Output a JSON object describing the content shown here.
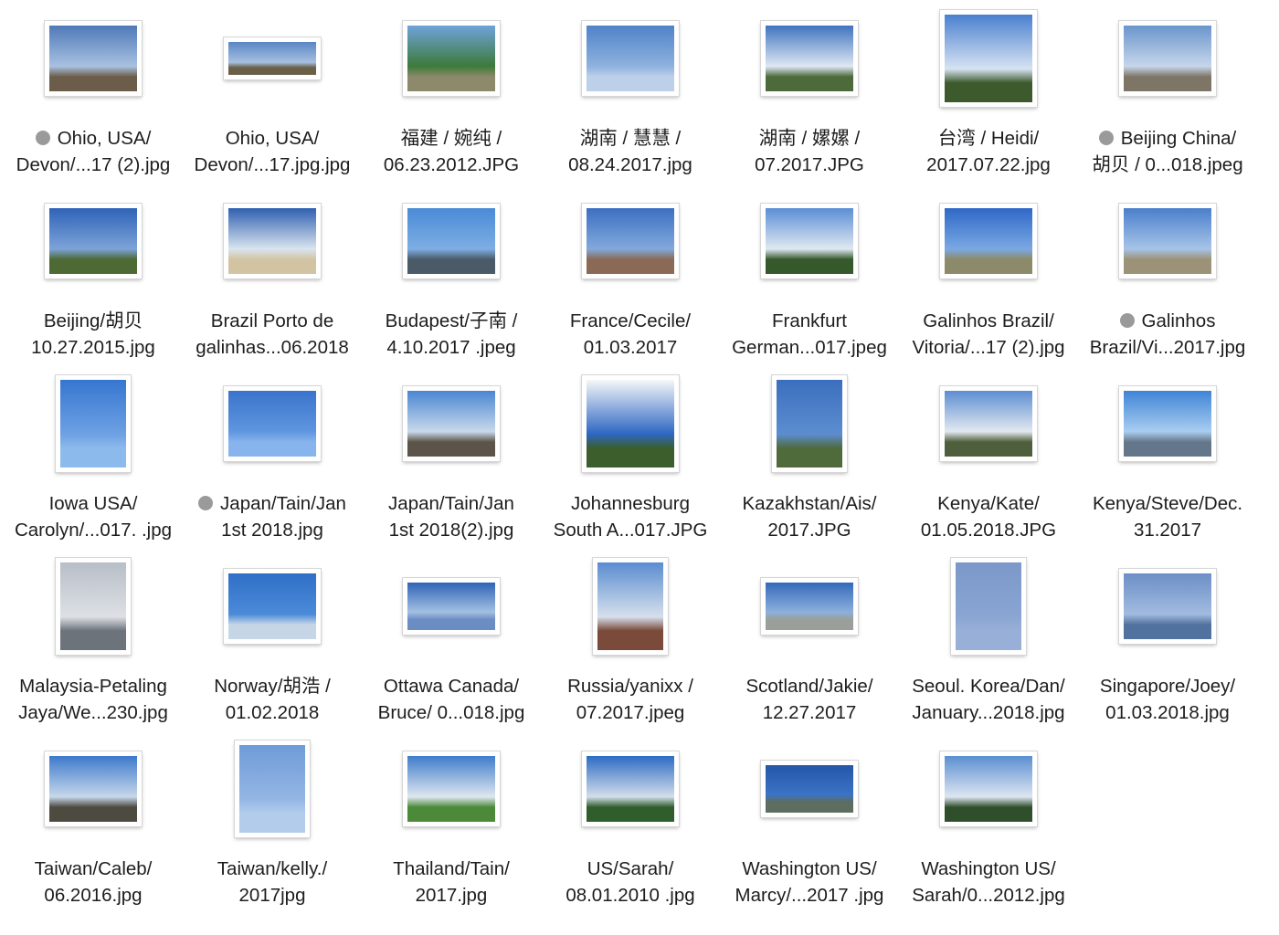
{
  "files": [
    {
      "name": "Ohio, USA/ Devon/...17 (2).jpg",
      "line1": "Ohio, USA/",
      "line2": "Devon/...17 (2).jpg",
      "tagged": true,
      "shape": "landscape",
      "colors": [
        "#4f79b8",
        "#a9c1e0",
        "#6b5d4a"
      ]
    },
    {
      "name": "Ohio, USA/ Devon/...17.jpg.jpg",
      "line1": "Ohio, USA/",
      "line2": "Devon/...17.jpg.jpg",
      "tagged": false,
      "shape": "wide",
      "colors": [
        "#5a86c4",
        "#a6c0e0",
        "#6a6048"
      ]
    },
    {
      "name": "福建 / 婉纯 / 06.23.2012.JPG",
      "line1": "福建 / 婉纯 /",
      "line2": "06.23.2012.JPG",
      "tagged": false,
      "shape": "landscape",
      "colors": [
        "#6fa3da",
        "#3d7a3a",
        "#8c8a6a"
      ]
    },
    {
      "name": "湖南 / 慧慧 / 08.24.2017.jpg",
      "line1": "湖南 / 慧慧 /",
      "line2": "08.24.2017.jpg",
      "tagged": false,
      "shape": "landscape",
      "colors": [
        "#4f82c8",
        "#8fb2de",
        "#bcd0ea"
      ]
    },
    {
      "name": "湖南 / 嫘嫘 / 07.2017.JPG",
      "line1": "湖南 / 嫘嫘 /",
      "line2": "07.2017.JPG",
      "tagged": false,
      "shape": "landscape",
      "colors": [
        "#3f74bf",
        "#dfe8f3",
        "#4c6a3a"
      ]
    },
    {
      "name": "台湾 / Heidi/ 2017.07.22.jpg",
      "line1": "台湾 / Heidi/",
      "line2": "2017.07.22.jpg",
      "tagged": false,
      "shape": "square",
      "colors": [
        "#4a80cf",
        "#d7e3f2",
        "#3d5a2c"
      ]
    },
    {
      "name": "Beijing China/ 胡贝 / 0...018.jpeg",
      "line1": "Beijing China/",
      "line2": "胡贝 / 0...018.jpeg",
      "tagged": true,
      "shape": "landscape",
      "colors": [
        "#6a95cc",
        "#c7d6ea",
        "#7d7565"
      ]
    },
    {
      "name": "Beijing/胡贝 10.27.2015.jpg",
      "line1": "Beijing/胡贝",
      "line2": "10.27.2015.jpg",
      "tagged": false,
      "shape": "landscape",
      "colors": [
        "#2f63b8",
        "#7da3d8",
        "#4d6a35"
      ]
    },
    {
      "name": "Brazil Porto de galinhas...06.2018",
      "line1": "Brazil Porto de",
      "line2": "galinhas...06.2018",
      "tagged": false,
      "shape": "landscape",
      "colors": [
        "#2f60b0",
        "#d9e4ef",
        "#d2c4a2"
      ]
    },
    {
      "name": "Budapest/子南 / 4.10.2017 .jpeg",
      "line1": "Budapest/子南 /",
      "line2": "4.10.2017 .jpeg",
      "tagged": false,
      "shape": "landscape",
      "colors": [
        "#4a8ad6",
        "#7eaee4",
        "#4a5a66"
      ]
    },
    {
      "name": "France/Cecile/ 01.03.2017",
      "line1": "France/Cecile/",
      "line2": "01.03.2017",
      "tagged": false,
      "shape": "landscape",
      "colors": [
        "#3c6fc2",
        "#82a9dc",
        "#8a6a55"
      ]
    },
    {
      "name": "Frankfurt German...017.jpeg",
      "line1": "Frankfurt",
      "line2": "German...017.jpeg",
      "tagged": false,
      "shape": "landscape",
      "colors": [
        "#5a8ed4",
        "#e0e8f2",
        "#35592b"
      ]
    },
    {
      "name": "Galinhos Brazil/ Vitoria/...17 (2).jpg",
      "line1": "Galinhos Brazil/",
      "line2": "Vitoria/...17 (2).jpg",
      "tagged": false,
      "shape": "landscape",
      "colors": [
        "#2f68c6",
        "#7aa8e3",
        "#8d8a6a"
      ]
    },
    {
      "name": "Galinhos Brazil/Vi...2017.jpg",
      "line1": "Galinhos",
      "line2": "Brazil/Vi...2017.jpg",
      "tagged": true,
      "shape": "landscape",
      "colors": [
        "#4a7fcc",
        "#a7c4e8",
        "#9c9277"
      ]
    },
    {
      "name": "Iowa USA/ Carolyn/...017. .jpg",
      "line1": "Iowa USA/",
      "line2": "Carolyn/...017. .jpg",
      "tagged": false,
      "shape": "portrait",
      "colors": [
        "#3676d0",
        "#6ea1e4",
        "#8dbaec"
      ]
    },
    {
      "name": "Japan/Tain/Jan 1st 2018.jpg",
      "line1": "Japan/Tain/Jan",
      "line2": "1st 2018.jpg",
      "tagged": true,
      "shape": "landscape",
      "colors": [
        "#3a74cc",
        "#5f96df",
        "#87b4ec"
      ]
    },
    {
      "name": "Japan/Tain/Jan 1st 2018(2).jpg",
      "line1": "Japan/Tain/Jan",
      "line2": "1st 2018(2).jpg",
      "tagged": false,
      "shape": "landscape",
      "colors": [
        "#4a86d2",
        "#c9d9ea",
        "#5c5448"
      ]
    },
    {
      "name": "Johannesburg South A...017.JPG",
      "line1": "Johannesburg",
      "line2": "South A...017.JPG",
      "tagged": false,
      "shape": "square",
      "colors": [
        "#f5f7f9",
        "#2d67c2",
        "#3b5e2c"
      ]
    },
    {
      "name": "Kazakhstan/Ais/ 2017.JPG",
      "line1": "Kazakhstan/Ais/",
      "line2": "2017.JPG",
      "tagged": false,
      "shape": "portrait",
      "colors": [
        "#3b6fbe",
        "#5c8dd0",
        "#4f6a3b"
      ]
    },
    {
      "name": "Kenya/Kate/ 01.05.2018.JPG",
      "line1": "Kenya/Kate/",
      "line2": "01.05.2018.JPG",
      "tagged": false,
      "shape": "landscape",
      "colors": [
        "#5d8ed2",
        "#e2e8f0",
        "#4f5e3c"
      ]
    },
    {
      "name": "Kenya/Steve/Dec. 31.2017",
      "line1": "Kenya/Steve/Dec.",
      "line2": "31.2017",
      "tagged": false,
      "shape": "landscape",
      "colors": [
        "#3f84d6",
        "#a9cdf0",
        "#64778a"
      ]
    },
    {
      "name": "Malaysia-Petaling Jaya/We...230.jpg",
      "line1": "Malaysia-Petaling",
      "line2": "Jaya/We...230.jpg",
      "tagged": false,
      "shape": "portrait",
      "colors": [
        "#b8bec6",
        "#dde1e6",
        "#6d737a"
      ]
    },
    {
      "name": "Norway/胡浩 / 01.02.2018",
      "line1": "Norway/胡浩 /",
      "line2": "01.02.2018",
      "tagged": false,
      "shape": "landscape",
      "colors": [
        "#2f6fc6",
        "#4c8bd9",
        "#c6d6e7"
      ]
    },
    {
      "name": "Ottawa Canada/ Bruce/ 0...018.jpg",
      "line1": "Ottawa Canada/",
      "line2": "Bruce/ 0...018.jpg",
      "tagged": false,
      "shape": "wide2",
      "colors": [
        "#2f64b6",
        "#a4c0e2",
        "#6c8cc4"
      ]
    },
    {
      "name": "Russia/yanixx / 07.2017.jpeg",
      "line1": "Russia/yanixx /",
      "line2": "07.2017.jpeg",
      "tagged": false,
      "shape": "portrait",
      "colors": [
        "#5a8cd0",
        "#d6e0ec",
        "#7a4a3a"
      ]
    },
    {
      "name": "Scotland/Jakie/ 12.27.2017",
      "line1": "Scotland/Jakie/",
      "line2": "12.27.2017",
      "tagged": false,
      "shape": "wide2",
      "colors": [
        "#3569ba",
        "#8cb0dd",
        "#9a9f9a"
      ]
    },
    {
      "name": "Seoul. Korea/Dan/ January...2018.jpg",
      "line1": "Seoul. Korea/Dan/",
      "line2": "January...2018.jpg",
      "tagged": false,
      "shape": "portrait",
      "colors": [
        "#7b98c9",
        "#8aa5d2",
        "#98b0d8"
      ]
    },
    {
      "name": "Singapore/Joey/ 01.03.2018.jpg",
      "line1": "Singapore/Joey/",
      "line2": "01.03.2018.jpg",
      "tagged": false,
      "shape": "landscape",
      "colors": [
        "#6c8fc6",
        "#a2bbe0",
        "#51719e"
      ]
    },
    {
      "name": "Taiwan/Caleb/ 06.2016.jpg",
      "line1": "Taiwan/Caleb/",
      "line2": "06.2016.jpg",
      "tagged": false,
      "shape": "landscape",
      "colors": [
        "#3d79cc",
        "#c7d8ea",
        "#4d4a40"
      ]
    },
    {
      "name": "Taiwan/kelly./ 2017jpg",
      "line1": "Taiwan/kelly./",
      "line2": "2017jpg",
      "tagged": false,
      "shape": "portrait",
      "colors": [
        "#6f9bd8",
        "#94b6e4",
        "#b3ccec"
      ]
    },
    {
      "name": "Thailand/Tain/ 2017.jpg",
      "line1": "Thailand/Tain/",
      "line2": "2017.jpg",
      "tagged": false,
      "shape": "landscape",
      "colors": [
        "#3f7ccb",
        "#dfe7ef",
        "#4c8a3a"
      ]
    },
    {
      "name": "US/Sarah/ 08.01.2010 .jpg",
      "line1": "US/Sarah/",
      "line2": "08.01.2010 .jpg",
      "tagged": false,
      "shape": "landscape",
      "colors": [
        "#2d6bc4",
        "#d3deea",
        "#2f5d2c"
      ]
    },
    {
      "name": "Washington US/ Marcy/...2017 .jpg",
      "line1": "Washington US/",
      "line2": "Marcy/...2017 .jpg",
      "tagged": false,
      "shape": "wide2",
      "colors": [
        "#2456a9",
        "#3c73c6",
        "#5d6d5f"
      ]
    },
    {
      "name": "Washington US/ Sarah/0...2012.jpg",
      "line1": "Washington US/",
      "line2": "Sarah/0...2012.jpg",
      "tagged": false,
      "shape": "landscape",
      "colors": [
        "#5b8fd2",
        "#dde6f0",
        "#2f4f2c"
      ]
    }
  ]
}
